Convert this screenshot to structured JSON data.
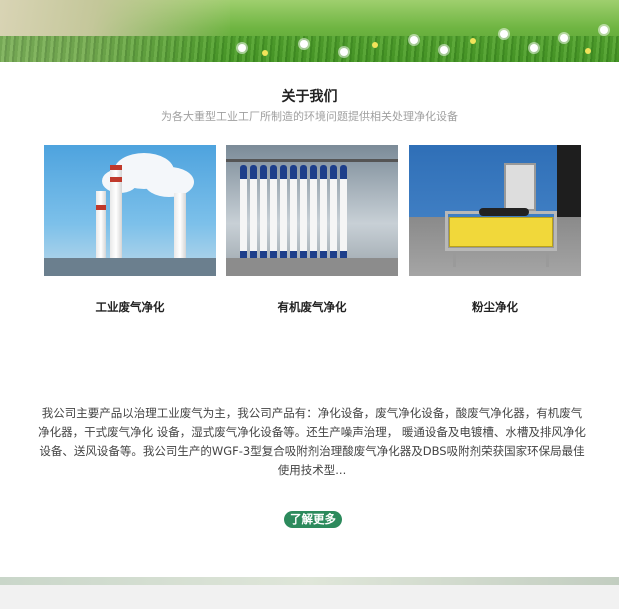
{
  "about": {
    "title": "关于我们",
    "subtitle": "为各大重型工业工厂所制造的环境问题提供相关处理净化设备"
  },
  "products": [
    {
      "label": "工业废气净化",
      "image": "industrial-chimneys-photo"
    },
    {
      "label": "有机废气净化",
      "image": "membrane-filtration-photo"
    },
    {
      "label": "粉尘净化",
      "image": "dust-collector-photo"
    }
  ],
  "description": "我公司主要产品以治理工业废气为主，我公司产品有：净化设备，废气净化设备，酸废气净化器，有机废气净化器，干式废气净化 设备，湿式废气净化设备等。还生产噪声治理， 暖通设备及电镀槽、水槽及排风净化设备、送风设备等。我公司生产的WGF-3型复合吸附剂治理酸废气净化器及DBS吸附剂荣获国家环保局最佳使用技术型...",
  "more_button": "了解更多",
  "colors": {
    "accent": "#2c8a5c",
    "subtitle": "#a0a0a0",
    "text": "#444444"
  }
}
